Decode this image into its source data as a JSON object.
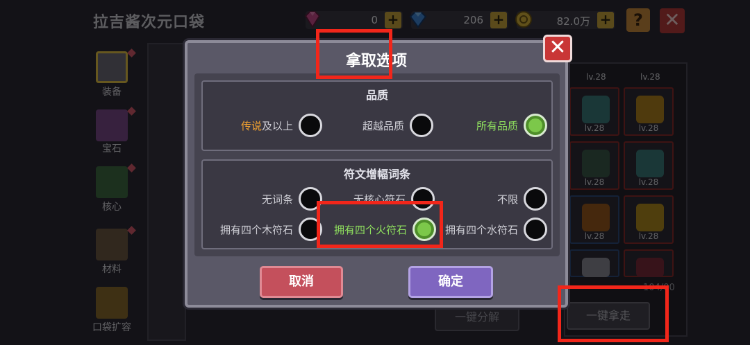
{
  "header": {
    "title": "拉吉酱次元口袋",
    "resources": [
      {
        "icon": "gem-pink-icon",
        "value": "0"
      },
      {
        "icon": "diamond-blue-icon",
        "value": "206"
      },
      {
        "icon": "gold-coin-icon",
        "value": "82.0万"
      }
    ],
    "help_label": "?",
    "close_label": "✕"
  },
  "sidebar": {
    "items": [
      {
        "label": "装备",
        "icon": "armor-icon",
        "active": true
      },
      {
        "label": "宝石",
        "icon": "gem-icon",
        "active": false
      },
      {
        "label": "核心",
        "icon": "core-icon",
        "active": false
      },
      {
        "label": "材料",
        "icon": "material-icon",
        "active": false
      },
      {
        "label": "口袋扩容",
        "icon": "chest-expand-icon",
        "active": false
      }
    ]
  },
  "inventory": {
    "level_label": "lv.28",
    "count_text": "104/00"
  },
  "bottom_buttons": {
    "decompose": "一键分解",
    "take_all": "一键拿走"
  },
  "modal": {
    "title": "拿取选项",
    "close_label": "✕",
    "quality": {
      "title": "品质",
      "options": [
        {
          "label_highlight": "传说",
          "label_rest": "及以上",
          "selected": false
        },
        {
          "label": "超越品质",
          "selected": false
        },
        {
          "label": "所有品质",
          "selected": true
        }
      ]
    },
    "affix": {
      "title": "符文增幅词条",
      "options": [
        {
          "label": "无词条",
          "selected": false
        },
        {
          "label": "无核心符石",
          "selected": false
        },
        {
          "label": "不限",
          "selected": false
        },
        {
          "label": "拥有四个木符石",
          "selected": false
        },
        {
          "label": "拥有四个火符石",
          "selected": true
        },
        {
          "label": "拥有四个水符石",
          "selected": false
        }
      ]
    },
    "cancel_label": "取消",
    "confirm_label": "确定"
  },
  "colors": {
    "highlight_box": "#f2261a",
    "selected_radio": "#7cc84a",
    "legendary_text": "#f2a230"
  }
}
